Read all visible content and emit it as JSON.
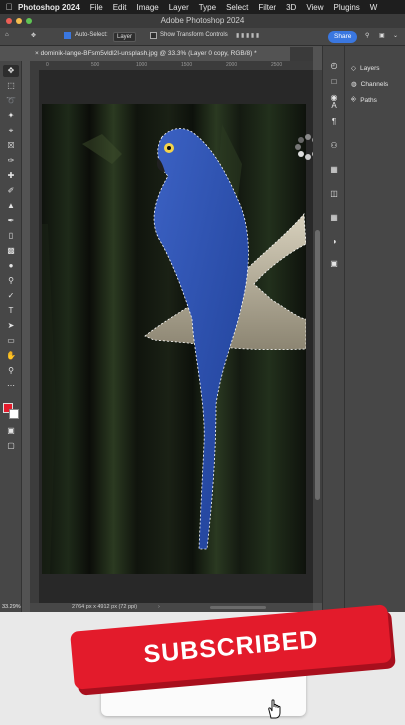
{
  "menubar": {
    "app_name": "Photoshop 2024",
    "menus": [
      "File",
      "Edit",
      "Image",
      "Layer",
      "Type",
      "Select",
      "Filter",
      "3D",
      "View",
      "Plugins",
      "W"
    ]
  },
  "window": {
    "title": "Adobe Photoshop 2024"
  },
  "options_bar": {
    "auto_select_label": "Auto-Select:",
    "auto_select_value": "Layer",
    "transform_controls_label": "Show Transform Controls",
    "share_label": "Share"
  },
  "document_tab": {
    "label": "dominik-lange-BFsm5vldl2I-unsplash.jpg @ 33.3% (Layer 0 copy, RGB/8) *"
  },
  "ruler": {
    "ticks": [
      "0",
      "500",
      "1000",
      "1500",
      "2000",
      "2500"
    ]
  },
  "status_bar": {
    "zoom": "33.29%",
    "doc_info": "2764 px x 4912 px (72 ppi)"
  },
  "panels": {
    "items": [
      "Layers",
      "Channels",
      "Paths"
    ]
  },
  "overlay": {
    "subscribe_label": "SUBSCRIBED"
  },
  "colors": {
    "accent": "#3a77e0",
    "foreground": "#e31b2b",
    "background": "#ffffff",
    "subscribe": "#e31b2b",
    "parrot": "#2b4fa8"
  }
}
